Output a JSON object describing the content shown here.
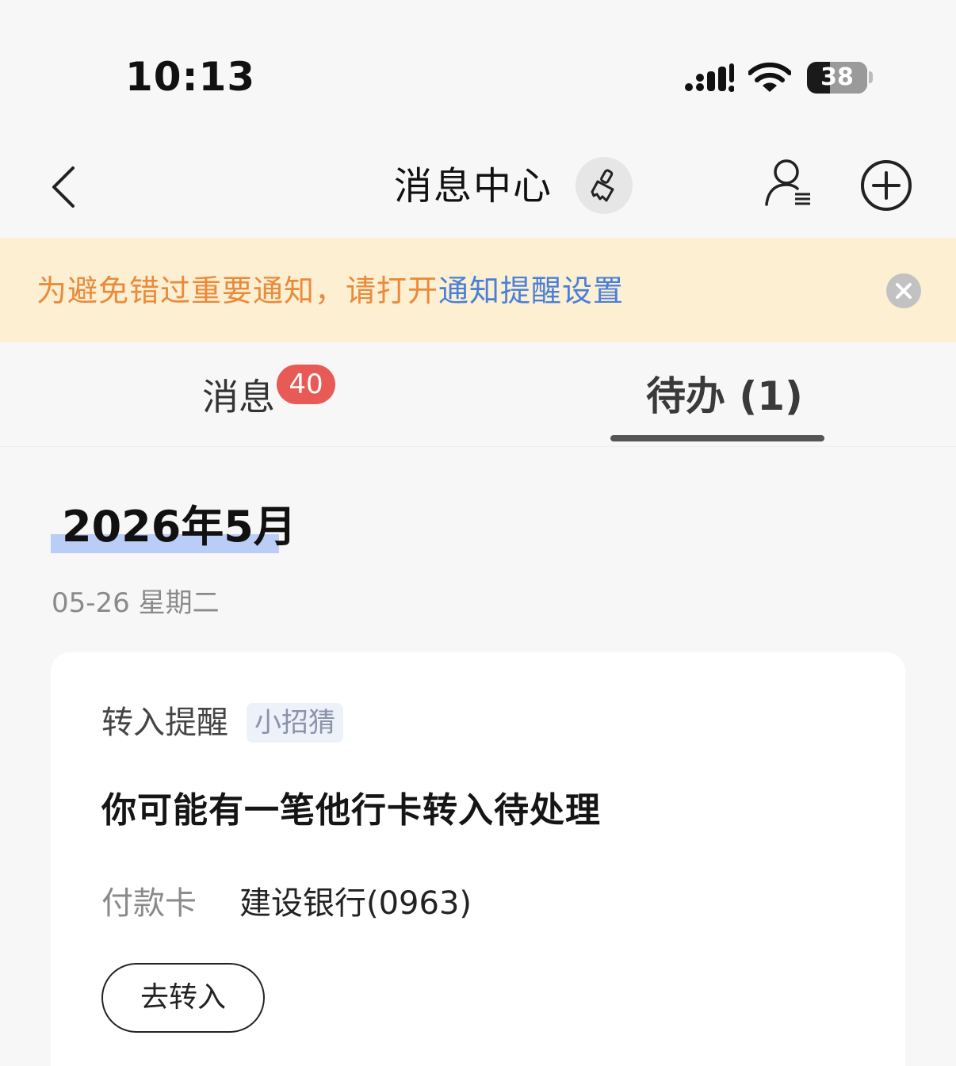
{
  "status_bar": {
    "time": "10:13",
    "battery_level": "38"
  },
  "nav": {
    "title": "消息中心"
  },
  "notice": {
    "prefix": "为避免错过重要通知，请打开",
    "link": "通知提醒设置"
  },
  "tabs": {
    "messages_label": "消息",
    "messages_badge": "40",
    "todo_label": "待办 (1)"
  },
  "content": {
    "month_heading": "2026年5月",
    "date_label": "05-26 星期二",
    "card": {
      "type": "转入提醒",
      "tag": "小招猜",
      "title": "你可能有一笔他行卡转入待处理",
      "field_label": "付款卡",
      "field_value": "建设银行(0963)",
      "action": "去转入"
    }
  },
  "colors": {
    "notice_bg": "#fcefd2",
    "notice_text": "#ea8a3a",
    "notice_link": "#4a7fd8",
    "badge": "#e85a55",
    "month_highlight": "#b9cdf6"
  }
}
